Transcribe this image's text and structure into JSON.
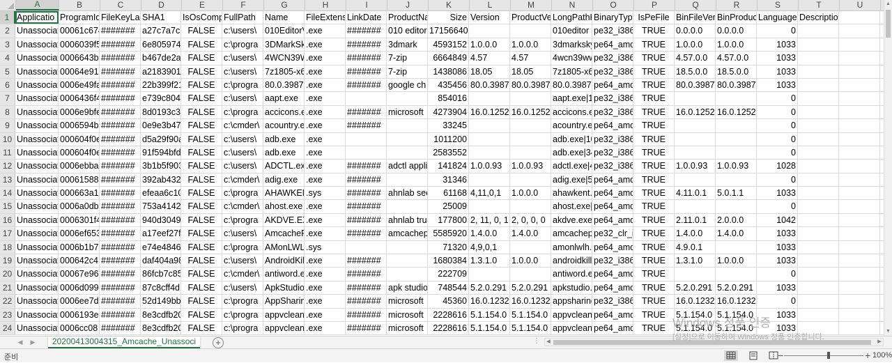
{
  "columns": [
    {
      "letter": "A",
      "w": 62,
      "selected": true
    },
    {
      "letter": "B",
      "w": 59
    },
    {
      "letter": "C",
      "w": 59
    },
    {
      "letter": "D",
      "w": 58
    },
    {
      "letter": "E",
      "w": 59
    },
    {
      "letter": "F",
      "w": 59
    },
    {
      "letter": "G",
      "w": 59
    },
    {
      "letter": "H",
      "w": 59
    },
    {
      "letter": "I",
      "w": 59
    },
    {
      "letter": "J",
      "w": 59
    },
    {
      "letter": "K",
      "w": 59
    },
    {
      "letter": "L",
      "w": 59
    },
    {
      "letter": "M",
      "w": 59
    },
    {
      "letter": "N",
      "w": 59
    },
    {
      "letter": "O",
      "w": 59
    },
    {
      "letter": "P",
      "w": 59
    },
    {
      "letter": "Q",
      "w": 59
    },
    {
      "letter": "R",
      "w": 59
    },
    {
      "letter": "S",
      "w": 59
    },
    {
      "letter": "T",
      "w": 59
    },
    {
      "letter": "U",
      "w": 59
    }
  ],
  "align": [
    "l",
    "l",
    "l",
    "l",
    "c",
    "l",
    "l",
    "l",
    "l",
    "l",
    "r",
    "l",
    "l",
    "l",
    "l",
    "c",
    "l",
    "l",
    "r",
    "l",
    "l"
  ],
  "rows": [
    [
      "Applicatio",
      "ProgramId",
      "FileKeyLas",
      "SHA1",
      "IsOsComp",
      "FullPath",
      "Name",
      "FileExtensi",
      "LinkDate",
      "ProductNa",
      "Size",
      "Version",
      "ProductVe",
      "LongPathH",
      "BinaryType",
      "IsPeFile",
      "BinFileVers",
      "BinProduct",
      "Language",
      "Description",
      ""
    ],
    [
      "Unassociat",
      "00061c674",
      "#######",
      "a27c7a7c7",
      "FALSE",
      "c:\\users\\",
      "010EditorV",
      ".exe",
      "#######",
      "010 editor",
      "17156640",
      "",
      "",
      "010editor",
      "pe32_i386",
      "TRUE",
      "0.0.0.0",
      "0.0.0.0",
      "0",
      "",
      ""
    ],
    [
      "Unassociat",
      "0006039f5",
      "#######",
      "6e8059749",
      "FALSE",
      "c:\\progra",
      "3DMarkSk",
      ".exe",
      "#######",
      "3dmark",
      "4593152",
      "1.0.0.0",
      "1.0.0.0",
      "3dmarksky",
      "pe64_amd",
      "TRUE",
      "1.0.0.0",
      "1.0.0.0",
      "1033",
      "",
      ""
    ],
    [
      "Unassociat",
      "0006643b",
      "#######",
      "b467de2a",
      "FALSE",
      "c:\\users\\",
      "4WCN39W",
      ".exe",
      "#######",
      "7-zip",
      "6664849",
      "4.57",
      "4.57",
      "4wcn39ww",
      "pe32_i386",
      "TRUE",
      "4.57.0.0",
      "4.57.0.0",
      "1033",
      "",
      ""
    ],
    [
      "Unassociat",
      "00064e91",
      "#######",
      "a2183901f",
      "FALSE",
      "c:\\users\\",
      "7z1805-x6",
      ".exe",
      "#######",
      "7-zip",
      "1438086",
      "18.05",
      "18.05",
      "7z1805-x6",
      "pe32_i386",
      "TRUE",
      "18.5.0.0",
      "18.5.0.0",
      "1033",
      "",
      ""
    ],
    [
      "Unassociat",
      "0006e49fa",
      "#######",
      "22b399f21",
      "FALSE",
      "c:\\progra",
      "80.0.3987.",
      ".exe",
      "#######",
      "google ch",
      "435456",
      "80.0.3987.",
      "80.0.3987.",
      "80.0.3987.",
      "pe64_amd",
      "TRUE",
      "80.0.3987.",
      "80.0.3987.",
      "1033",
      "",
      ""
    ],
    [
      "Unassociat",
      "0006436f4",
      "#######",
      "e739c8042",
      "FALSE",
      "c:\\users\\",
      "aapt.exe",
      ".exe",
      "",
      "",
      "854016",
      "",
      "",
      "aapt.exe|1",
      "pe32_i386",
      "TRUE",
      "",
      "",
      "0",
      "",
      ""
    ],
    [
      "Unassociat",
      "0006e9bfe",
      "#######",
      "8d0193c3a",
      "FALSE",
      "c:\\progra",
      "accicons.e",
      ".exe",
      "#######",
      "microsoft",
      "4273904",
      "16.0.12527",
      "16.0.12527",
      "accicons.e",
      "pe32_i386",
      "TRUE",
      "16.0.12527",
      "16.0.12527",
      "0",
      "",
      ""
    ],
    [
      "Unassociat",
      "0006594b",
      "#######",
      "0e9e3b47",
      "FALSE",
      "c:\\cmder\\",
      "acountry.e",
      ".exe",
      "#######",
      "",
      "33245",
      "",
      "",
      "acountry.e",
      "pe64_amd",
      "TRUE",
      "",
      "",
      "0",
      "",
      ""
    ],
    [
      "Unassociat",
      "000604f0e",
      "#######",
      "d5a29f90a",
      "FALSE",
      "c:\\users\\",
      "adb.exe",
      ".exe",
      "",
      "",
      "1011200",
      "",
      "",
      "adb.exe|10",
      "pe32_i386",
      "TRUE",
      "",
      "",
      "0",
      "",
      ""
    ],
    [
      "Unassociat",
      "000604f0e",
      "#######",
      "91f594bfd",
      "FALSE",
      "c:\\users\\",
      "adb.exe",
      ".exe",
      "",
      "",
      "2583552",
      "",
      "",
      "adb.exe|34",
      "pe32_i386",
      "TRUE",
      "",
      "",
      "0",
      "",
      ""
    ],
    [
      "Unassociat",
      "0006ebba",
      "#######",
      "3b1b5f903",
      "FALSE",
      "c:\\users\\",
      "ADCTL.exe",
      ".exe",
      "#######",
      "adctl appli",
      "141824",
      "1.0.0.93",
      "1.0.0.93",
      "adctl.exe|4",
      "pe32_i386",
      "TRUE",
      "1.0.0.93",
      "1.0.0.93",
      "1028",
      "",
      ""
    ],
    [
      "Unassociat",
      "00061588",
      "#######",
      "392ab432",
      "FALSE",
      "c:\\cmder\\",
      "adig.exe",
      ".exe",
      "#######",
      "",
      "31346",
      "",
      "",
      "adig.exe|5",
      "pe64_amd",
      "TRUE",
      "",
      "",
      "0",
      "",
      ""
    ],
    [
      "Unassociat",
      "000663a12",
      "#######",
      "efeaa6c10",
      "FALSE",
      "c:\\progra",
      "AHAWKEN",
      ".sys",
      "#######",
      "ahnlab sec",
      "61168",
      "4,11,0,1",
      "1.0.0.0",
      "ahawkent.s",
      "pe64_amd",
      "TRUE",
      "4.11.0.1",
      "5.0.1.1",
      "1033",
      "",
      ""
    ],
    [
      "Unassociat",
      "0006a0db",
      "#######",
      "753a4142c",
      "FALSE",
      "c:\\cmder\\",
      "ahost.exe",
      ".exe",
      "#######",
      "",
      "25009",
      "",
      "",
      "ahost.exe|",
      "pe64_amd",
      "TRUE",
      "",
      "",
      "0",
      "",
      ""
    ],
    [
      "Unassociat",
      "0006301f4",
      "#######",
      "940d3049",
      "FALSE",
      "c:\\progra",
      "AKDVE.EXI",
      ".exe",
      "#######",
      "ahnlab true",
      "177800",
      "2, 11, 0, 1",
      "2, 0, 0, 0",
      "akdve.exe|",
      "pe64_amd",
      "TRUE",
      "2.11.0.1",
      "2.0.0.0",
      "1042",
      "",
      ""
    ],
    [
      "Unassociat",
      "0006ef653",
      "#######",
      "a17eef27f",
      "FALSE",
      "c:\\users\\",
      "AmcacheP",
      ".exe",
      "#######",
      "amcachep",
      "5585920",
      "1.4.0.0",
      "1.4.0.0",
      "amcachep",
      "pe32_clr_il",
      "TRUE",
      "1.4.0.0",
      "1.4.0.0",
      "1033",
      "",
      ""
    ],
    [
      "Unassociat",
      "0006b1b7",
      "#######",
      "e74e4846a",
      "FALSE",
      "c:\\progra",
      "AMonLWL",
      ".sys",
      "",
      "",
      "71320",
      "4,9,0,1",
      "",
      "amonlwlh.s",
      "pe64_amd",
      "TRUE",
      "4.9.0.1",
      "",
      "1033",
      "",
      ""
    ],
    [
      "Unassociat",
      "000642c4",
      "#######",
      "daf404a98",
      "FALSE",
      "c:\\users\\",
      "AndroidKil",
      ".exe",
      "#######",
      "",
      "1680384",
      "1.3.1.0",
      "1.0.0.0",
      "androidkill",
      "pe32_i386",
      "TRUE",
      "1.3.1.0",
      "1.0.0.0",
      "1033",
      "",
      ""
    ],
    [
      "Unassociat",
      "00067e96",
      "#######",
      "86fcb7c85",
      "FALSE",
      "c:\\cmder\\",
      "antiword.e",
      ".exe",
      "#######",
      "",
      "222709",
      "",
      "",
      "antiword.e",
      "pe64_amd",
      "TRUE",
      "",
      "",
      "0",
      "",
      ""
    ],
    [
      "Unassociat",
      "0006d0997",
      "#######",
      "87c8cff4d",
      "FALSE",
      "c:\\users\\",
      "ApkStudio",
      ".exe",
      "#######",
      "apk studio",
      "748544",
      "5.2.0.291",
      "5.2.0.291",
      "apkstudio.",
      "pe64_amd",
      "TRUE",
      "5.2.0.291",
      "5.2.0.291",
      "1033",
      "",
      ""
    ],
    [
      "Unassociat",
      "0006ee7d",
      "#######",
      "52d149bb",
      "FALSE",
      "c:\\progra",
      "AppSharin",
      ".exe",
      "#######",
      "microsoft",
      "45360",
      "16.0.12325",
      "16.0.12325",
      "appsharing",
      "pe32_i386",
      "TRUE",
      "16.0.12325",
      "16.0.12325",
      "0",
      "",
      ""
    ],
    [
      "Unassociat",
      "0006193e",
      "#######",
      "8e3cdfb20",
      "FALSE",
      "c:\\progra",
      "appvclean",
      ".exe",
      "#######",
      "microsoft",
      "2228616",
      "5.1.154.0",
      "5.1.154.0",
      "appvclean",
      "pe64_amd",
      "TRUE",
      "5.1.154.0",
      "5.1.154.0",
      "1033",
      "",
      ""
    ],
    [
      "Unassociat",
      "0006cc08",
      "#######",
      "8e3cdfb20",
      "FALSE",
      "c:\\progra",
      "appvclean",
      ".exe",
      "#######",
      "microsoft",
      "2228616",
      "5.1.154.0",
      "5.1.154.0",
      "appvclean",
      "pe64_amd",
      "TRUE",
      "5.1.154.0",
      "5.1.154.0",
      "1033",
      "",
      ""
    ]
  ],
  "sheet_tab": "20200413004315_Amcache_Unassoci",
  "status": "준비",
  "zoom": "100%",
  "watermark": {
    "line1": "Windows 정품 인증",
    "line2": "[설정]으로 이동하여 Windows 정품 인증합니다."
  }
}
